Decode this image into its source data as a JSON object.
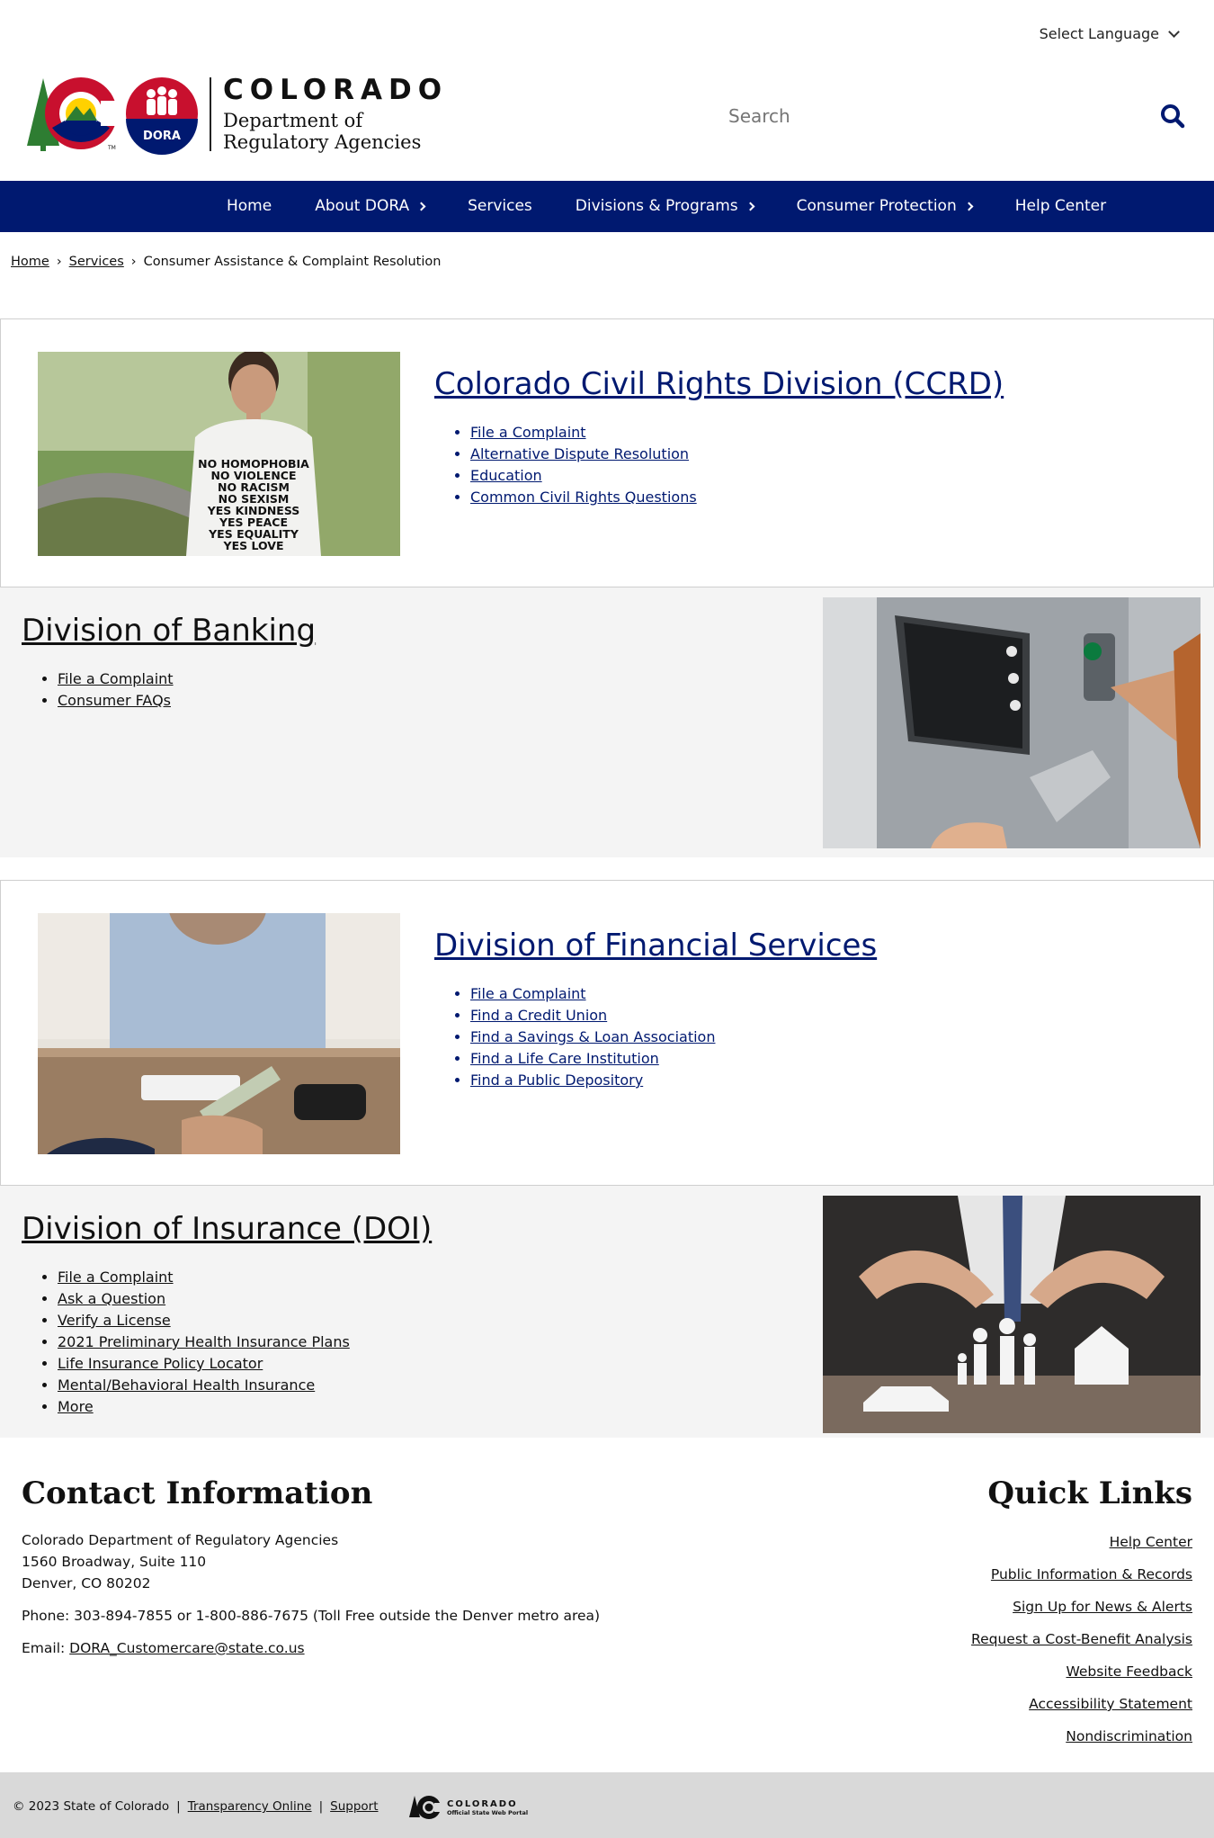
{
  "language": {
    "label": "Select Language"
  },
  "logo": {
    "wordmark": "COLORADO",
    "line1": "Department of",
    "line2": "Regulatory Agencies",
    "badge": "DORA",
    "tm": "TM"
  },
  "search": {
    "placeholder": "Search"
  },
  "nav": {
    "items": [
      {
        "label": "Home",
        "has_arrow": false
      },
      {
        "label": "About DORA",
        "has_arrow": true
      },
      {
        "label": "Services",
        "has_arrow": false
      },
      {
        "label": "Divisions & Programs",
        "has_arrow": true
      },
      {
        "label": "Consumer Protection",
        "has_arrow": true
      },
      {
        "label": "Help Center",
        "has_arrow": false
      }
    ]
  },
  "breadcrumb": {
    "home": "Home",
    "services": "Services",
    "current": "Consumer Assistance & Complaint Resolution",
    "sep": "›"
  },
  "sections": {
    "ccrd": {
      "title": "Colorado Civil Rights Division (CCRD)",
      "links": [
        "File a Complaint",
        "Alternative Dispute Resolution",
        "Education",
        "Common Civil Rights Questions"
      ],
      "shirt_text": [
        "NO HOMOPHOBIA",
        "NO VIOLENCE",
        "NO RACISM",
        "NO SEXISM",
        "YES KINDNESS",
        "YES PEACE",
        "YES EQUALITY",
        "YES LOVE"
      ]
    },
    "banking": {
      "title": "Division of Banking",
      "links": [
        "File a Complaint",
        "Consumer FAQs"
      ]
    },
    "financial": {
      "title": "Division of Financial Services",
      "links": [
        "File a Complaint",
        "Find a Credit Union",
        "Find a Savings & Loan Association",
        "Find a Life Care Institution",
        "Find a Public Depository"
      ]
    },
    "insurance": {
      "title": "Division of Insurance (DOI)",
      "links": [
        "File a Complaint",
        "Ask a Question",
        "Verify a License",
        "2021 Preliminary Health Insurance Plans",
        "Life Insurance Policy Locator",
        "Mental/Behavioral Health Insurance",
        "More"
      ]
    }
  },
  "contact": {
    "heading": "Contact Information",
    "org": "Colorado Department of Regulatory Agencies",
    "street": "1560 Broadway, Suite 110",
    "city": "Denver, CO 80202",
    "phone": "Phone: 303-894-7855 or 1-800-886-7675 (Toll Free outside the Denver metro area)",
    "email_label": "Email:",
    "email": "DORA_Customercare@state.co.us"
  },
  "quick_links": {
    "heading": "Quick Links",
    "items": [
      "Help Center",
      "Public Information & Records",
      "Sign Up for News & Alerts",
      "Request a Cost-Benefit Analysis",
      "Website Feedback",
      "Accessibility Statement",
      "Nondiscrimination"
    ]
  },
  "footer": {
    "copyright": "© 2023 State of Colorado",
    "sep": "|",
    "transparency": "Transparency Online",
    "support": "Support",
    "state_logo_title": "COLORADO",
    "state_logo_sub": "Official State Web Portal"
  },
  "colors": {
    "nav": "#001970",
    "link_blue": "#001970",
    "gray_bg": "#f4f4f4",
    "footer_bg": "#d9d9d9"
  }
}
